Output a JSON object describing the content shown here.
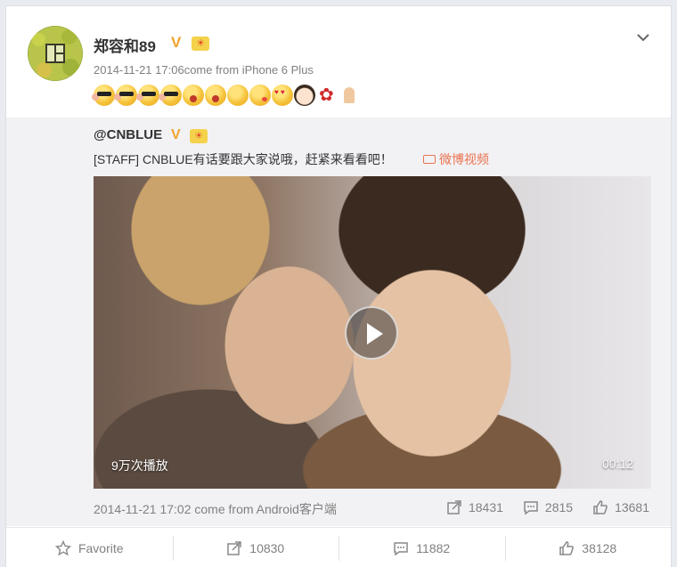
{
  "post": {
    "username": "郑容和89",
    "timestamp": "2014-11-21 17:06",
    "source": "come from iPhone 6 Plus",
    "emojis": [
      "sunglasses",
      "sunglasses",
      "sunglasses",
      "sunglasses",
      "crying",
      "crying",
      "grimace",
      "kiss",
      "heart-eyes",
      "boy-face",
      "rose",
      "pray"
    ],
    "verified_icon": "verified-v-icon",
    "rank_icon": "rank-badge-icon"
  },
  "repost": {
    "username": "@CNBLUE",
    "text": "[STAFF] CNBLUE有话要跟大家说哦，赶紧来看看吧！",
    "video_link": "微博视频",
    "video": {
      "views": "9万次播放",
      "duration": "00:12"
    },
    "timestamp": "2014-11-21 17:02",
    "source": "come from Android客户端",
    "reposts": "18431",
    "comments": "2815",
    "likes": "13681"
  },
  "actions": {
    "favorite": "Favorite",
    "reposts": "10830",
    "comments": "11882",
    "likes": "38128"
  },
  "colors": {
    "accent_orange": "#eb7350",
    "verified_gold": "#f0a22a",
    "meta_gray": "#808080"
  }
}
